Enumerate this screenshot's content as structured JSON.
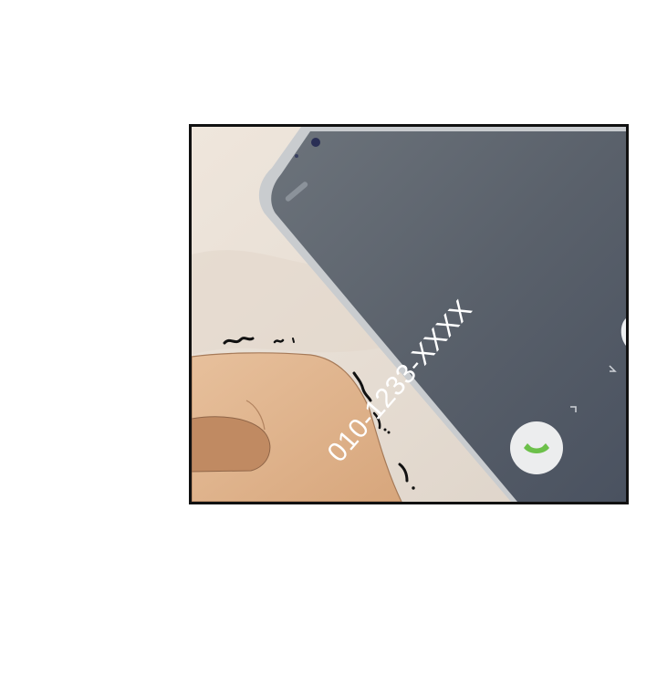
{
  "phone": {
    "number": "010-1233-XXXX",
    "screen_color": "#5b626d",
    "answer_icon": "phone-answer-icon",
    "answer_color": "#6cc04a"
  },
  "sound_effect": "~ ~ ~",
  "colors": {
    "background": "#e9e1d8",
    "skin": "#e0b58e",
    "border": "#111111"
  }
}
